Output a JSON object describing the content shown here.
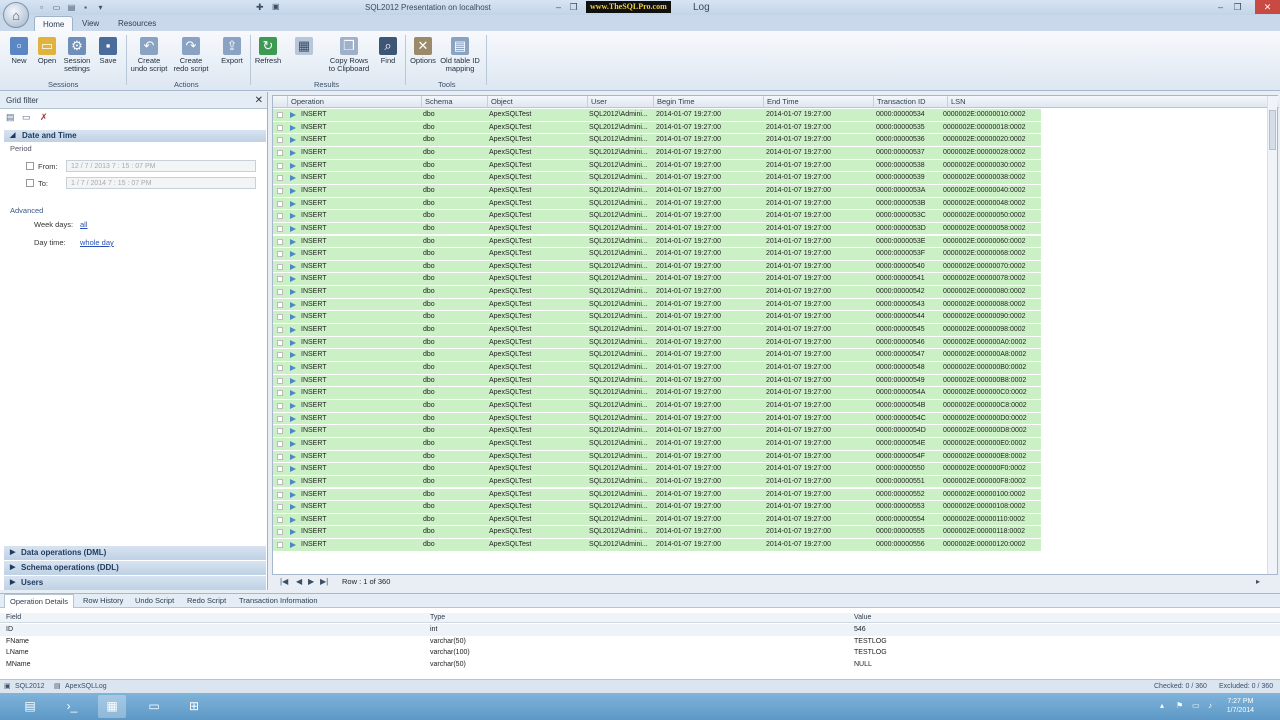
{
  "window": {
    "title": "SQL2012 Presentation on localhost",
    "watermark": "www.TheSQLPro.com",
    "title_suffix": "Log"
  },
  "tabs": [
    "Home",
    "View",
    "Resources"
  ],
  "ribbon": {
    "buttons": [
      {
        "label": "New",
        "icon": "new-icon"
      },
      {
        "label": "Open",
        "icon": "folder-open-icon"
      },
      {
        "label": "Session settings",
        "icon": "session-settings-icon"
      },
      {
        "label": "Save",
        "icon": "save-icon"
      },
      {
        "label": "Create undo script",
        "icon": "undo-script-icon"
      },
      {
        "label": "Create redo script",
        "icon": "redo-script-icon"
      },
      {
        "label": "Export",
        "icon": "export-icon"
      },
      {
        "label": "Refresh",
        "icon": "refresh-icon"
      },
      {
        "label": "Copy Rows to Clipboard",
        "icon": "copy-rows-icon"
      },
      {
        "label": "Find",
        "icon": "binoculars-icon"
      },
      {
        "label": "Options",
        "icon": "options-icon"
      },
      {
        "label": "Old table ID mapping",
        "icon": "table-mapping-icon"
      }
    ],
    "groups": [
      "Sessions",
      "Actions",
      "Results",
      "Tools"
    ]
  },
  "filter": {
    "title": "Grid filter",
    "date_section": "Date and Time",
    "period_label": "Period",
    "from_label": "From:",
    "from_value": "12 /  7 / 2013       7 : 15 : 07    PM",
    "to_label": "To:",
    "to_value": "1  /  7 / 2014       7 : 15 : 07    PM",
    "advanced_label": "Advanced",
    "week_days_label": "Week days:",
    "week_days_value": "all",
    "day_time_label": "Day time:",
    "day_time_value": "whole day",
    "collapsed_sections": [
      "Data operations (DML)",
      "Schema operations (DDL)",
      "Users"
    ]
  },
  "grid": {
    "columns": [
      "Operation",
      "Schema",
      "Object",
      "User",
      "Begin Time",
      "End Time",
      "Transaction ID",
      "LSN"
    ],
    "operation": "INSERT",
    "schema": "dbo",
    "object": "ApexSQLTest",
    "user": "SQL2012\\Admini...",
    "begin_time": "2014-01-07 19:27:00",
    "end_time": "2014-01-07 19:27:00",
    "transaction_ids": [
      "0000:00000534",
      "0000:00000535",
      "0000:00000536",
      "0000:00000537",
      "0000:00000538",
      "0000:00000539",
      "0000:0000053A",
      "0000:0000053B",
      "0000:0000053C",
      "0000:0000053D",
      "0000:0000053E",
      "0000:0000053F",
      "0000:00000540",
      "0000:00000541",
      "0000:00000542",
      "0000:00000543",
      "0000:00000544",
      "0000:00000545",
      "0000:00000546",
      "0000:00000547",
      "0000:00000548",
      "0000:00000549",
      "0000:0000054A",
      "0000:0000054B",
      "0000:0000054C",
      "0000:0000054D",
      "0000:0000054E",
      "0000:0000054F",
      "0000:00000550",
      "0000:00000551",
      "0000:00000552",
      "0000:00000553",
      "0000:00000554",
      "0000:00000555",
      "0000:00000556"
    ],
    "lsns": [
      "0000002E:00000010:0002",
      "0000002E:00000018:0002",
      "0000002E:00000020:0002",
      "0000002E:00000028:0002",
      "0000002E:00000030:0002",
      "0000002E:00000038:0002",
      "0000002E:00000040:0002",
      "0000002E:00000048:0002",
      "0000002E:00000050:0002",
      "0000002E:00000058:0002",
      "0000002E:00000060:0002",
      "0000002E:00000068:0002",
      "0000002E:00000070:0002",
      "0000002E:00000078:0002",
      "0000002E:00000080:0002",
      "0000002E:00000088:0002",
      "0000002E:00000090:0002",
      "0000002E:00000098:0002",
      "0000002E:000000A0:0002",
      "0000002E:000000A8:0002",
      "0000002E:000000B0:0002",
      "0000002E:000000B8:0002",
      "0000002E:000000C0:0002",
      "0000002E:000000C8:0002",
      "0000002E:000000D0:0002",
      "0000002E:000000D8:0002",
      "0000002E:000000E0:0002",
      "0000002E:000000E8:0002",
      "0000002E:000000F0:0002",
      "0000002E:000000F8:0002",
      "0000002E:00000100:0002",
      "0000002E:00000108:0002",
      "0000002E:00000110:0002",
      "0000002E:00000118:0002",
      "0000002E:00000120:0002"
    ],
    "row_color": "#ccf0c6",
    "nav_text": "Row : 1 of 360"
  },
  "details": {
    "tabs": [
      "Operation Details",
      "Row History",
      "Undo Script",
      "Redo Script",
      "Transaction Information"
    ],
    "columns": [
      "Field",
      "Type",
      "Value"
    ],
    "rows": [
      {
        "field": "ID",
        "type": "int",
        "value": "546"
      },
      {
        "field": "FName",
        "type": "varchar(50)",
        "value": "TESTLOG"
      },
      {
        "field": "LName",
        "type": "varchar(100)",
        "value": "TESTLOG"
      },
      {
        "field": "MName",
        "type": "varchar(50)",
        "value": "NULL"
      }
    ]
  },
  "status": {
    "server": "SQL2012",
    "database": "ApexSQLLog",
    "checked": "Checked: 0 / 360",
    "excluded": "Excluded: 0 / 360"
  },
  "taskbar": {
    "time": "7:27 PM",
    "date": "1/7/2014"
  }
}
